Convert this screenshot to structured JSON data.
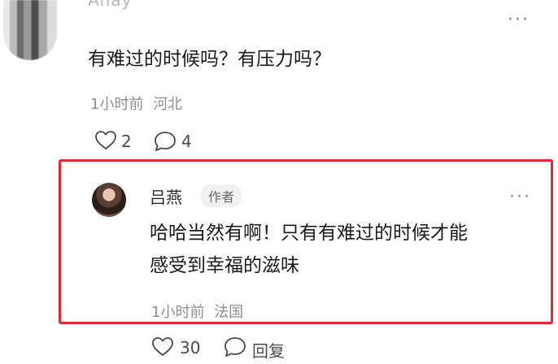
{
  "comment": {
    "author_name_partial": "Anay",
    "text": "有难过的时候吗？有压力吗？",
    "time": "1小时前",
    "location": "河北",
    "likes": "2",
    "replies": "4",
    "more_icon": "ellipsis-icon"
  },
  "reply": {
    "author_name": "吕燕",
    "author_badge": "作者",
    "text_line1": "哈哈当然有啊！只有有难过的时候才能",
    "text_line2": "感受到幸福的滋味",
    "time": "1小时前",
    "location": "法国",
    "likes": "30",
    "reply_label": "回复",
    "more_icon": "ellipsis-icon"
  },
  "colors": {
    "highlight_border": "#e8262d",
    "meta_text": "#8e8e8e",
    "body_text": "#1b1b1b"
  }
}
